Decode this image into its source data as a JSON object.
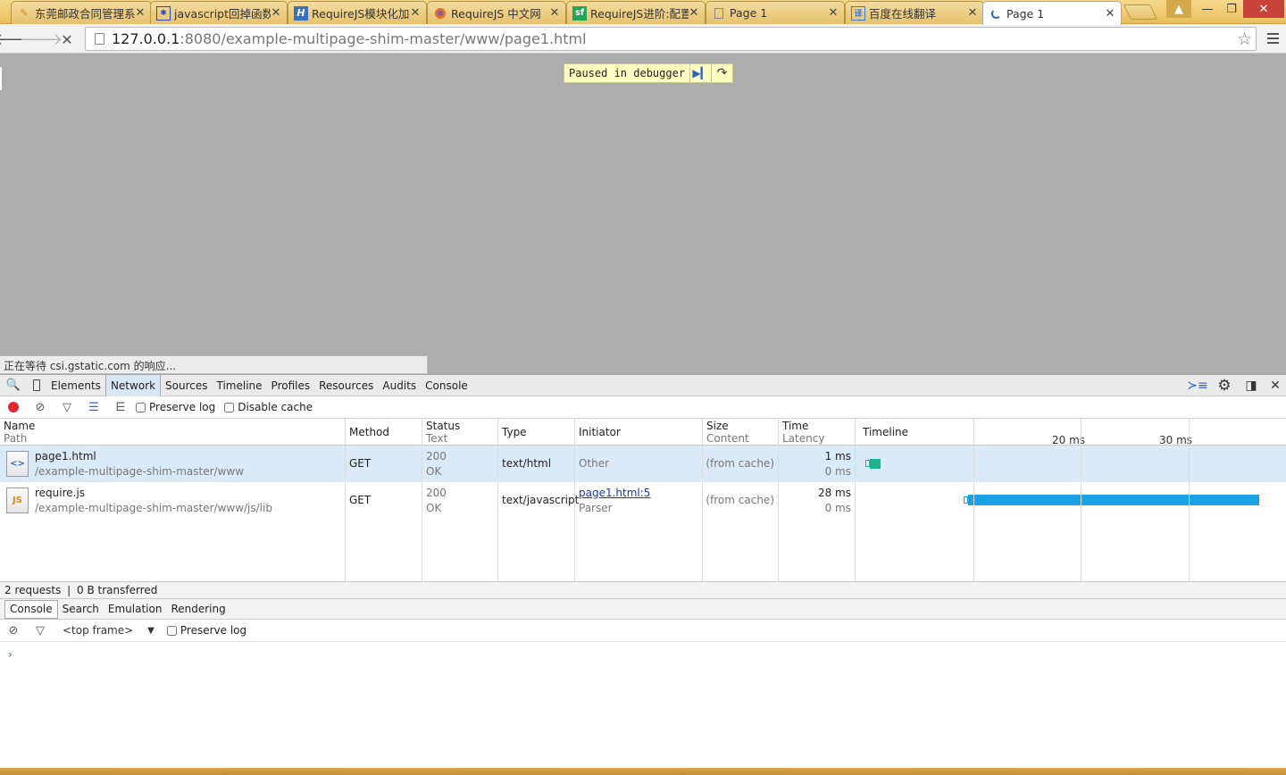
{
  "tabs": [
    {
      "title": "东莞邮政合同管理系统",
      "favicon": "doc-pencil-icon",
      "color": "#c98b2e"
    },
    {
      "title": "javascript回掉函数",
      "favicon": "paw-icon",
      "color": "#2b49b0"
    },
    {
      "title": "RequireJS模块化加",
      "favicon": "H",
      "color": "#3b6fc2"
    },
    {
      "title": "RequireJS 中文网",
      "favicon": "circle-icon",
      "color": "#e0722a"
    },
    {
      "title": "RequireJS进阶:配置",
      "favicon": "sf",
      "color": "#23a559"
    },
    {
      "title": "Page 1",
      "favicon": "page-icon",
      "color": "#888888"
    },
    {
      "title": "百度在线翻译",
      "favicon": "translate-icon",
      "color": "#3c7ad6"
    },
    {
      "title": "Page 1",
      "favicon": "loading-icon",
      "color": "#2a62c6",
      "active": true
    }
  ],
  "window_controls": {
    "user": "▲",
    "minimize": "—",
    "maximize": "❐",
    "close": "✕"
  },
  "omnibox": {
    "host": "127.0.0.1",
    "path": ":8080/example-multipage-shim-master/www/page1.html"
  },
  "viewport": {
    "paused_label": "Paused in debugger",
    "status_text": "正在等待 csi.gstatic.com 的响应..."
  },
  "devtools": {
    "panels": [
      "Elements",
      "Network",
      "Sources",
      "Timeline",
      "Profiles",
      "Resources",
      "Audits",
      "Console"
    ],
    "selected_panel": "Network",
    "network_toolbar": {
      "preserve_log": "Preserve log",
      "disable_cache": "Disable cache"
    },
    "columns": {
      "name": "Name",
      "path": "Path",
      "method": "Method",
      "status": "Status",
      "status_text": "Text",
      "type": "Type",
      "initiator": "Initiator",
      "size": "Size",
      "content": "Content",
      "time": "Time",
      "latency": "Latency",
      "timeline": "Timeline"
    },
    "timeline_ticks": [
      "20 ms",
      "30 ms"
    ],
    "requests": [
      {
        "name": "page1.html",
        "path": "/example-multipage-shim-master/www",
        "method": "GET",
        "status": "200",
        "status_text": "OK",
        "type": "text/html",
        "initiator": "Other",
        "initiator_sub": "",
        "size": "(from cache)",
        "time": "1 ms",
        "latency": "0 ms",
        "icon": "<>",
        "start_ms": 0.5,
        "duration_ms": 1.0
      },
      {
        "name": "require.js",
        "path": "/example-multipage-shim-master/www/js/lib",
        "method": "GET",
        "status": "200",
        "status_text": "OK",
        "type": "text/javascript",
        "initiator": "page1.html:5",
        "initiator_sub": "Parser",
        "size": "(from cache)",
        "time": "28 ms",
        "latency": "0 ms",
        "icon": "JS",
        "start_ms": 9.6,
        "duration_ms": 27.0
      }
    ],
    "summary": "2 requests  ❘  0 B transferred",
    "drawer_tabs": [
      "Console",
      "Search",
      "Emulation",
      "Rendering"
    ],
    "console": {
      "frame": "<top frame>",
      "preserve_log": "Preserve log",
      "prompt": "›"
    }
  },
  "colors": {
    "timeline_bar": "#1aa1e6",
    "timeline_bar_small": "#1fb28f",
    "selected_row": "#dbeaf8"
  }
}
